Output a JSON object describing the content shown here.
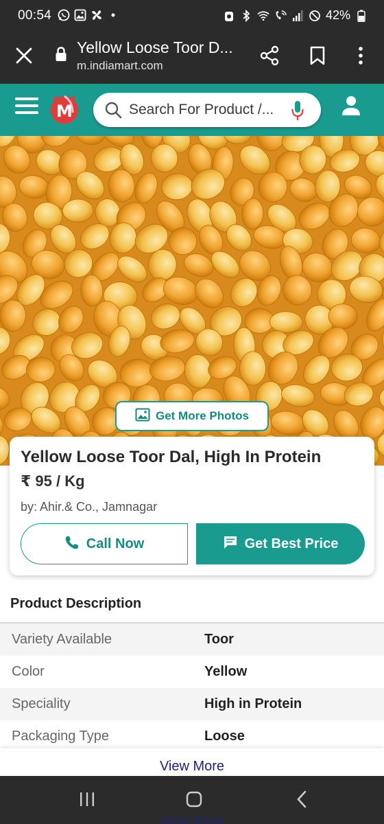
{
  "status_bar": {
    "time": "00:54",
    "battery": "42%",
    "left_icons": [
      "whatsapp-icon",
      "gallery-icon",
      "fan-icon",
      "dot-icon"
    ],
    "right_icons": [
      "alarm-icon",
      "bluetooth-icon",
      "wifi-icon",
      "wifi-call-icon",
      "signal-icon",
      "do-not-disturb-icon",
      "battery-icon"
    ]
  },
  "browser": {
    "title": "Yellow Loose Toor D...",
    "url": "m.indiamart.com",
    "icons": [
      "close-icon",
      "lock-icon",
      "share-icon",
      "bookmark-icon",
      "more-vert-icon"
    ]
  },
  "header": {
    "search_placeholder": "Search For Product /...",
    "brand_color": "#1a9b8f",
    "icons": [
      "hamburger-icon",
      "indiamart-logo",
      "search-icon",
      "mic-icon",
      "user-icon"
    ]
  },
  "hero": {
    "photos_button": "Get More Photos",
    "icon": "image-icon"
  },
  "product": {
    "title": "Yellow Loose Toor Dal, High In Protein",
    "price": "₹ 95 / Kg",
    "seller": "by: Ahir.& Co., Jamnagar",
    "call_label": "Call Now",
    "price_label": "Get Best Price"
  },
  "description": {
    "title": "Product Description",
    "rows": [
      {
        "key": "Variety Available",
        "value": "Toor"
      },
      {
        "key": "Color",
        "value": "Yellow"
      },
      {
        "key": "Speciality",
        "value": "High in Protein"
      },
      {
        "key": "Packaging Type",
        "value": "Loose"
      }
    ],
    "view_more": "View More"
  },
  "nav": {
    "icons": [
      "recent-apps-icon",
      "home-icon",
      "back-icon"
    ]
  }
}
